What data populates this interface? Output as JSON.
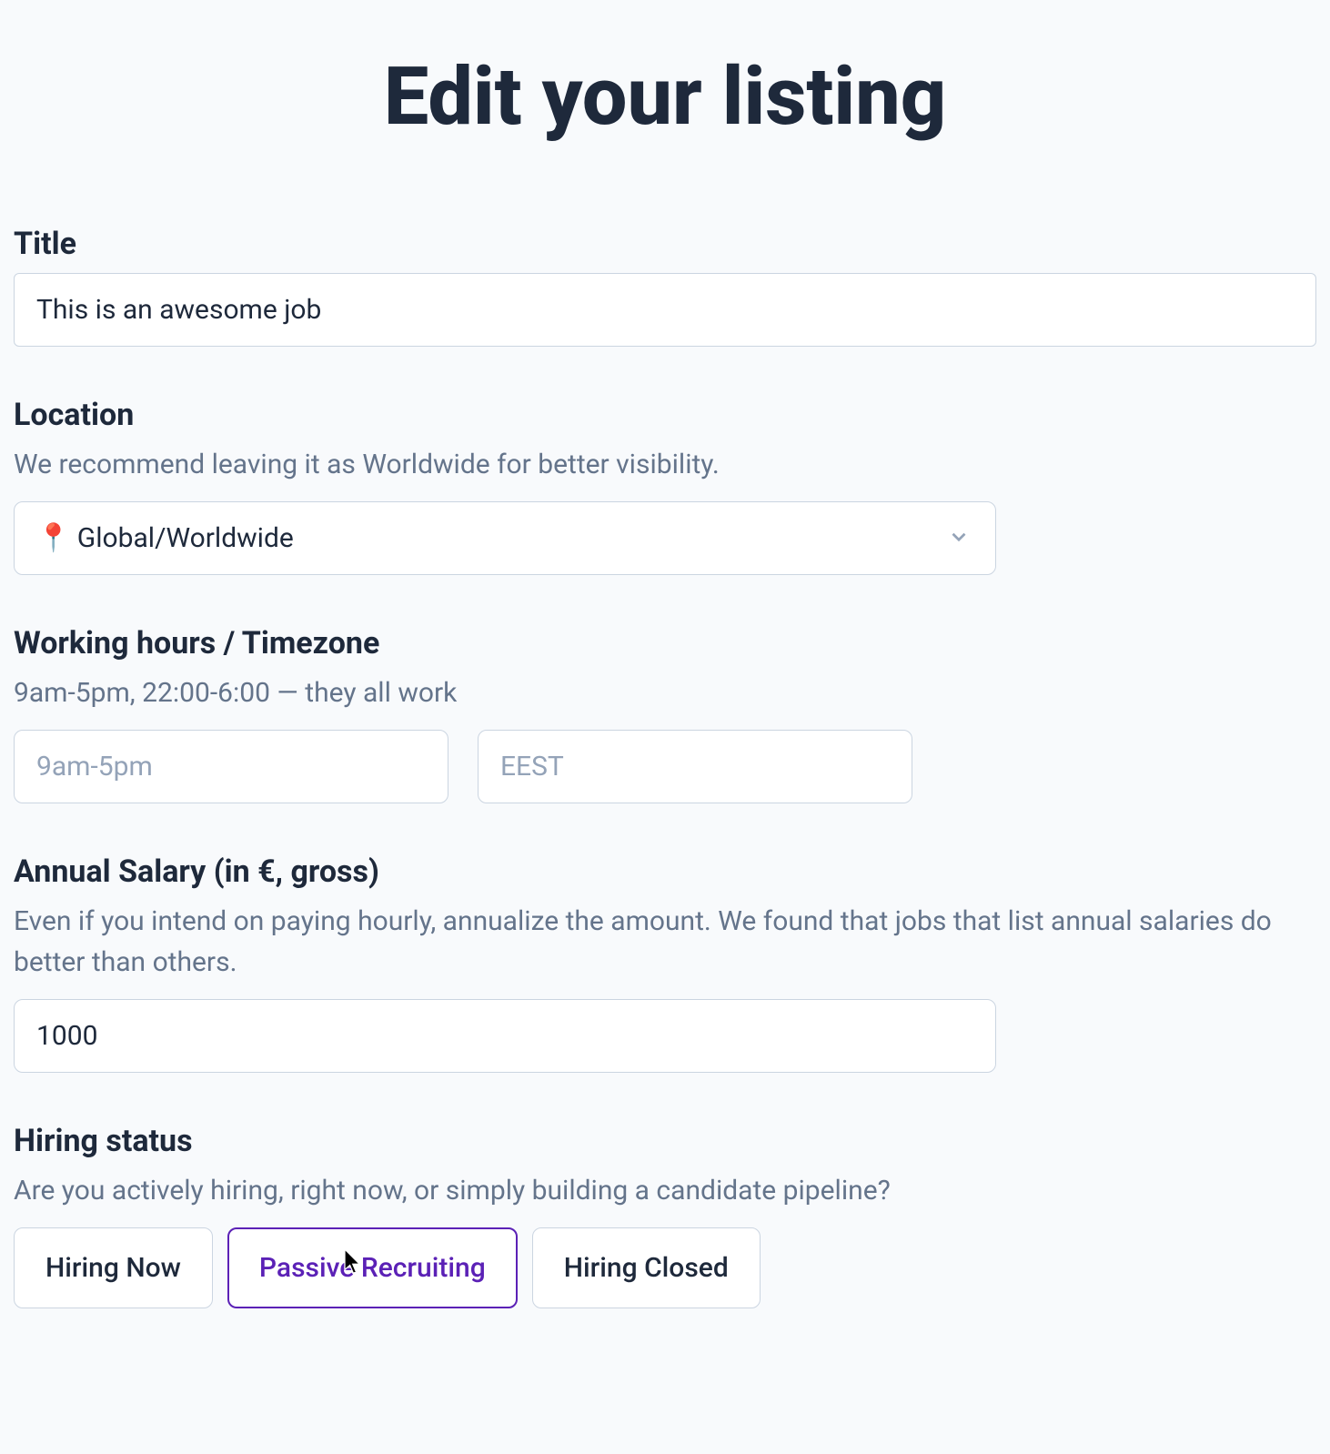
{
  "page": {
    "title": "Edit your listing"
  },
  "fields": {
    "title": {
      "label": "Title",
      "value": "This is an awesome job"
    },
    "location": {
      "label": "Location",
      "hint": "We recommend leaving it as Worldwide for better visibility.",
      "value": "📍 Global/Worldwide"
    },
    "hours": {
      "label": "Working hours / Timezone",
      "hint": "9am-5pm, 22:00-6:00 — they all work",
      "time_placeholder": "9am-5pm",
      "time_value": "",
      "tz_placeholder": "EEST",
      "tz_value": ""
    },
    "salary": {
      "label": "Annual Salary (in €, gross)",
      "hint": "Even if you intend on paying hourly, annualize the amount. We found that jobs that list annual salaries do better than others.",
      "value": "1000"
    },
    "status": {
      "label": "Hiring status",
      "hint": "Are you actively hiring, right now, or simply building a candidate pipeline?",
      "options": {
        "now": "Hiring Now",
        "passive": "Passive Recruiting",
        "closed": "Hiring Closed"
      },
      "selected": "passive"
    }
  }
}
